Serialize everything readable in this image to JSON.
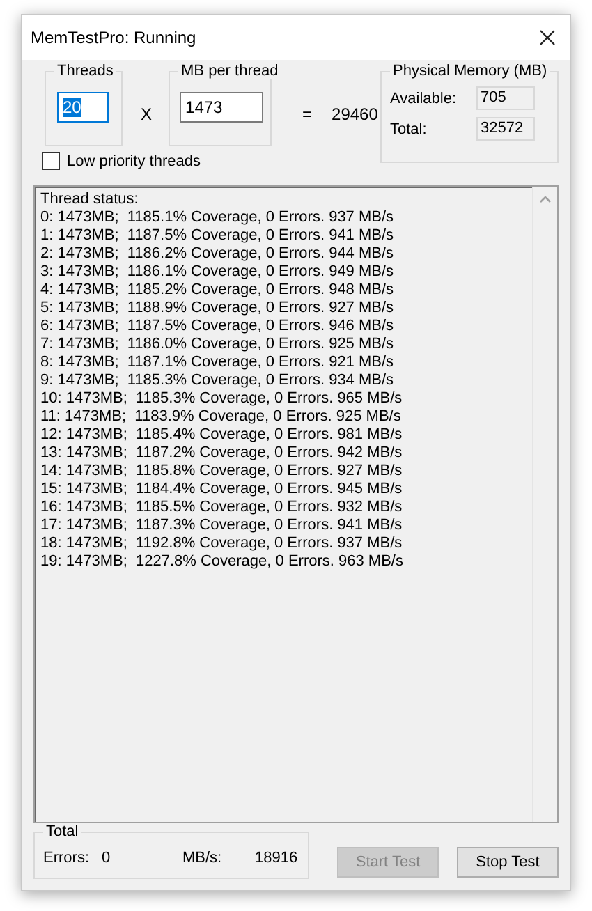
{
  "window": {
    "title": "MemTestPro: Running"
  },
  "threads": {
    "label": "Threads",
    "value": "20",
    "text_selected": true
  },
  "multiply_sign": "X",
  "mb_per_thread": {
    "label": "MB per thread",
    "value": "1473"
  },
  "equals_sign": "=",
  "total_mb": "29460",
  "physical_memory": {
    "title": "Physical Memory (MB)",
    "fields": [
      {
        "label": "Available:",
        "value": "705"
      },
      {
        "label": "Total:",
        "value": "32572"
      }
    ]
  },
  "low_priority": {
    "label": "Low priority threads",
    "checked": false
  },
  "thread_status": {
    "lines": [
      "Thread status:",
      "0: 1473MB;  1185.1% Coverage, 0 Errors. 937 MB/s",
      "1: 1473MB;  1187.5% Coverage, 0 Errors. 941 MB/s",
      "2: 1473MB;  1186.2% Coverage, 0 Errors. 944 MB/s",
      "3: 1473MB;  1186.1% Coverage, 0 Errors. 949 MB/s",
      "4: 1473MB;  1185.2% Coverage, 0 Errors. 948 MB/s",
      "5: 1473MB;  1188.9% Coverage, 0 Errors. 927 MB/s",
      "6: 1473MB;  1187.5% Coverage, 0 Errors. 946 MB/s",
      "7: 1473MB;  1186.0% Coverage, 0 Errors. 925 MB/s",
      "8: 1473MB;  1187.1% Coverage, 0 Errors. 921 MB/s",
      "9: 1473MB;  1185.3% Coverage, 0 Errors. 934 MB/s",
      "10: 1473MB;  1185.3% Coverage, 0 Errors. 965 MB/s",
      "11: 1473MB;  1183.9% Coverage, 0 Errors. 925 MB/s",
      "12: 1473MB;  1185.4% Coverage, 0 Errors. 981 MB/s",
      "13: 1473MB;  1187.2% Coverage, 0 Errors. 942 MB/s",
      "14: 1473MB;  1185.8% Coverage, 0 Errors. 927 MB/s",
      "15: 1473MB;  1184.4% Coverage, 0 Errors. 945 MB/s",
      "16: 1473MB;  1185.5% Coverage, 0 Errors. 932 MB/s",
      "17: 1473MB;  1187.3% Coverage, 0 Errors. 941 MB/s",
      "18: 1473MB;  1192.8% Coverage, 0 Errors. 937 MB/s",
      "19: 1473MB;  1227.8% Coverage, 0 Errors. 963 MB/s"
    ]
  },
  "total": {
    "title": "Total",
    "errors_label": "Errors:",
    "errors": "0",
    "rate_label": "MB/s:",
    "rate": "18916"
  },
  "buttons": [
    {
      "label": "Start Test",
      "disabled": true
    },
    {
      "label": "Stop Test",
      "disabled": false
    }
  ]
}
